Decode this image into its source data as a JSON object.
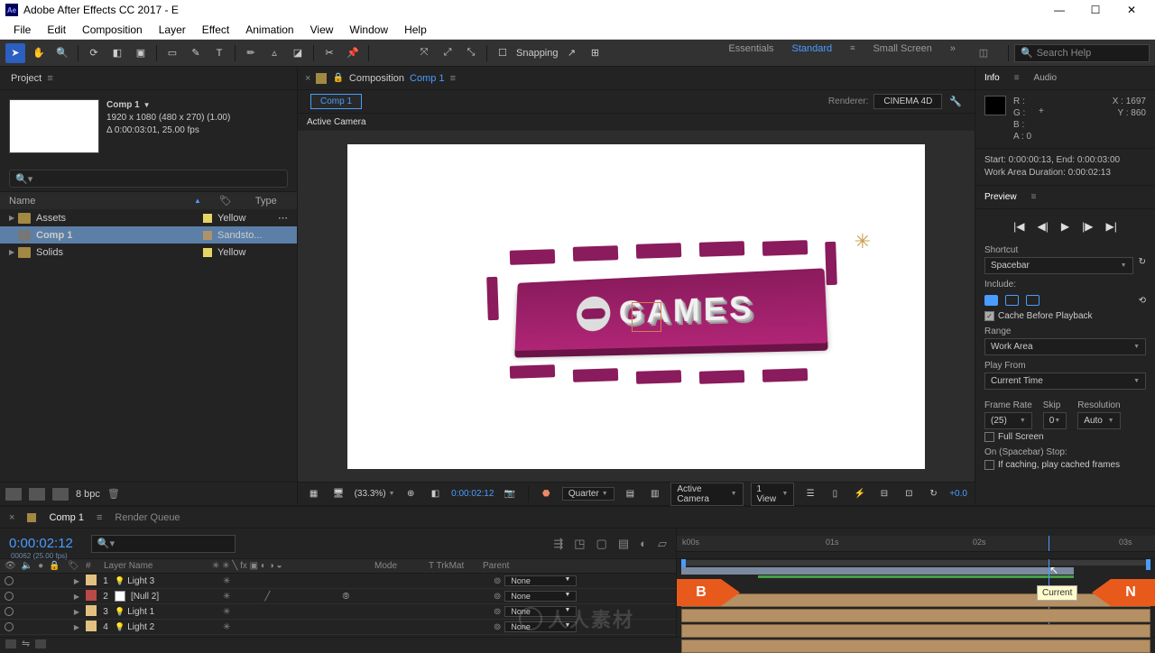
{
  "title": "Adobe After Effects CC 2017 - E",
  "menu": [
    "File",
    "Edit",
    "Composition",
    "Layer",
    "Effect",
    "Animation",
    "View",
    "Window",
    "Help"
  ],
  "opbar": {
    "snapping": "Snapping",
    "search_ph": "Search Help"
  },
  "workspace": [
    "Essentials",
    "Standard",
    "Small Screen"
  ],
  "project": {
    "tab": "Project",
    "comp_name": "Comp 1",
    "meta_line1": "1920 x 1080  (480 x 270) (1.00)",
    "meta_line2": "Δ 0:00:03:01, 25.00 fps",
    "columns": {
      "name": "Name",
      "type": "Type"
    },
    "items": [
      {
        "name": "Assets",
        "label": "Yellow",
        "kind": "folder"
      },
      {
        "name": "Comp 1",
        "label": "Sandsto...",
        "kind": "comp"
      },
      {
        "name": "Solids",
        "label": "Yellow",
        "kind": "folder"
      }
    ],
    "bpc": "8 bpc"
  },
  "comp_panel": {
    "title_prefix": "Composition",
    "title_name": "Comp 1",
    "flow": "Comp 1",
    "renderer_label": "Renderer:",
    "renderer": "CINEMA 4D",
    "active_cam": "Active Camera",
    "text3d": "GAMES"
  },
  "viewbar": {
    "zoom": "(33.3%)",
    "time": "0:00:02:12",
    "res": "Quarter",
    "cam": "Active Camera",
    "views": "1 View",
    "exposure": "+0.0"
  },
  "info": {
    "tab_info": "Info",
    "tab_audio": "Audio",
    "R": "R :",
    "G": "G :",
    "B": "B :",
    "A": "A :  0",
    "X": "X : 1697",
    "Y": "Y :  860",
    "wk1": "Start: 0:00:00:13, End: 0:00:03:00",
    "wk2": "Work Area Duration: 0:00:02:13"
  },
  "preview": {
    "tab": "Preview",
    "shortcut_lbl": "Shortcut",
    "shortcut": "Spacebar",
    "include_lbl": "Include:",
    "cache": "Cache Before Playback",
    "range_lbl": "Range",
    "range": "Work Area",
    "playfrom_lbl": "Play From",
    "playfrom": "Current Time",
    "fr_lbl": "Frame Rate",
    "skip_lbl": "Skip",
    "res_lbl": "Resolution",
    "fr": "(25)",
    "skip": "0",
    "res": "Auto",
    "fullscreen": "Full Screen",
    "stop_lbl": "On (Spacebar) Stop:",
    "ifcache": "If caching, play cached frames"
  },
  "timeline": {
    "tab": "Comp 1",
    "rq": "Render Queue",
    "time": "0:00:02:12",
    "sub": "00062 (25.00 fps)",
    "cols": {
      "num": "#",
      "name": "Layer Name",
      "mode": "Mode",
      "trk": "T   TrkMat",
      "parent": "Parent"
    },
    "ticks": [
      "k00s",
      "01s",
      "02s",
      "03s"
    ],
    "layers": [
      {
        "n": 1,
        "name": "Light 3",
        "kind": "light",
        "parent": "None",
        "chip": "#e2c080"
      },
      {
        "n": 2,
        "name": "[Null 2]",
        "kind": "null",
        "parent": "None",
        "chip": "#b94a48"
      },
      {
        "n": 3,
        "name": "Light 1",
        "kind": "light",
        "parent": "None",
        "chip": "#e2c080"
      },
      {
        "n": 4,
        "name": "Light 2",
        "kind": "light",
        "parent": "None",
        "chip": "#e2c080"
      }
    ],
    "arrowB": "B",
    "arrowN": "N",
    "tip": "Current"
  }
}
